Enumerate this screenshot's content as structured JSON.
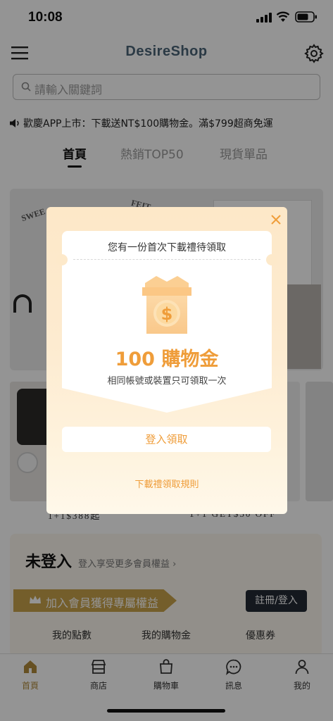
{
  "status_bar": {
    "time": "10:08"
  },
  "header": {
    "app_name": "DesireShop"
  },
  "search": {
    "placeholder": "請輸入關鍵詞"
  },
  "announcement": {
    "text": "歡慶APP上市：下載送NT$100購物金。滿$799超商免運"
  },
  "tabs": [
    {
      "label": "首頁",
      "active": true
    },
    {
      "label": "熱銷TOP50",
      "active": false
    },
    {
      "label": "現貨單品",
      "active": false
    }
  ],
  "banner": {
    "text_left": "SWEE",
    "text_right": "FEIT"
  },
  "products": [
    {
      "label": "1+1$388起"
    },
    {
      "label": "1+1 GET$50 OFF"
    }
  ],
  "member": {
    "title": "未登入",
    "subtitle": "登入享受更多會員權益 ›",
    "join_label": "加入會員獲得專屬權益",
    "register_label": "註冊/登入",
    "stats": [
      "我的點數",
      "我的購物金",
      "優惠券"
    ]
  },
  "bottom_nav": [
    {
      "label": "首頁",
      "icon": "home-icon",
      "active": true
    },
    {
      "label": "商店",
      "icon": "store-icon",
      "active": false
    },
    {
      "label": "購物車",
      "icon": "shopping-bag-icon",
      "active": false
    },
    {
      "label": "訊息",
      "icon": "chat-icon",
      "active": false
    },
    {
      "label": "我的",
      "icon": "user-icon",
      "active": false
    }
  ],
  "modal": {
    "heading": "您有一份首次下載禮待領取",
    "amount": "100 購物金",
    "note": "相同帳號或裝置只可領取一次",
    "claim_button": "登入領取",
    "rules_link": "下載禮領取規則"
  },
  "colors": {
    "accent_orange": "#ef9d3a",
    "gold": "#c9a24a",
    "logo": "#4a6478",
    "dark_button": "#232a35"
  }
}
